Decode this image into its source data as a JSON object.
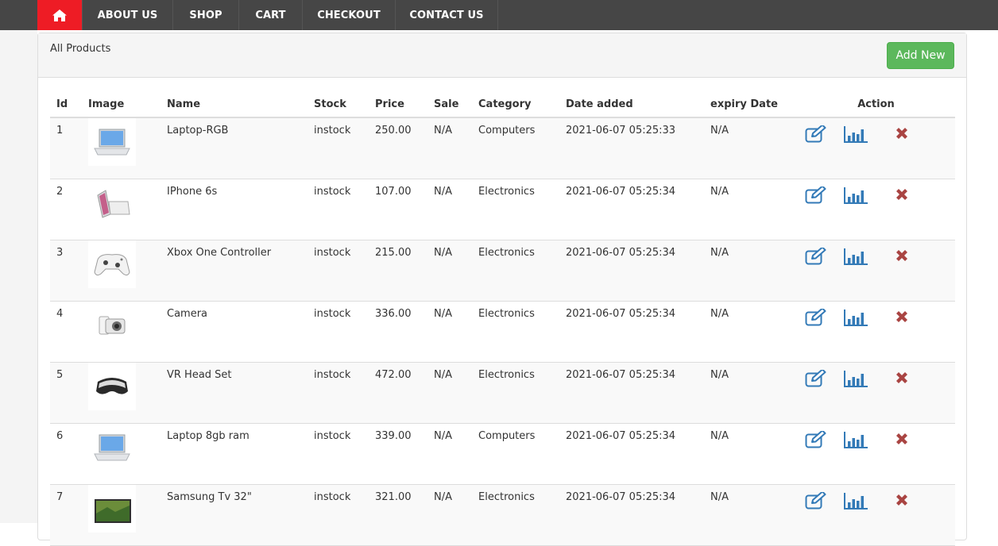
{
  "nav": {
    "home_icon": "home-icon",
    "items": [
      {
        "label": "ABOUT US"
      },
      {
        "label": "SHOP"
      },
      {
        "label": "CART"
      },
      {
        "label": "CHECKOUT"
      },
      {
        "label": "CONTACT US"
      }
    ]
  },
  "panel": {
    "title": "All Products",
    "add_button": "Add New"
  },
  "table": {
    "headers": {
      "id": "Id",
      "image": "Image",
      "name": "Name",
      "stock": "Stock",
      "price": "Price",
      "sale": "Sale",
      "category": "Category",
      "date_added": "Date added",
      "expiry_date": "expiry Date",
      "action": "Action"
    },
    "rows": [
      {
        "id": "1",
        "image": "laptop-image",
        "name": "Laptop-RGB",
        "stock": "instock",
        "price": "250.00",
        "sale": "N/A",
        "category": "Computers",
        "date_added": "2021-06-07 05:25:33",
        "expiry_date": "N/A"
      },
      {
        "id": "2",
        "image": "phone-image",
        "name": "IPhone 6s",
        "stock": "instock",
        "price": "107.00",
        "sale": "N/A",
        "category": "Electronics",
        "date_added": "2021-06-07 05:25:34",
        "expiry_date": "N/A"
      },
      {
        "id": "3",
        "image": "controller-image",
        "name": "Xbox One Controller",
        "stock": "instock",
        "price": "215.00",
        "sale": "N/A",
        "category": "Electronics",
        "date_added": "2021-06-07 05:25:34",
        "expiry_date": "N/A"
      },
      {
        "id": "4",
        "image": "camera-image",
        "name": "Camera",
        "stock": "instock",
        "price": "336.00",
        "sale": "N/A",
        "category": "Electronics",
        "date_added": "2021-06-07 05:25:34",
        "expiry_date": "N/A"
      },
      {
        "id": "5",
        "image": "vr-headset-image",
        "name": "VR Head Set",
        "stock": "instock",
        "price": "472.00",
        "sale": "N/A",
        "category": "Electronics",
        "date_added": "2021-06-07 05:25:34",
        "expiry_date": "N/A"
      },
      {
        "id": "6",
        "image": "laptop-image",
        "name": "Laptop 8gb ram",
        "stock": "instock",
        "price": "339.00",
        "sale": "N/A",
        "category": "Computers",
        "date_added": "2021-06-07 05:25:34",
        "expiry_date": "N/A"
      },
      {
        "id": "7",
        "image": "tv-image",
        "name": "Samsung Tv 32\"",
        "stock": "instock",
        "price": "321.00",
        "sale": "N/A",
        "category": "Electronics",
        "date_added": "2021-06-07 05:25:34",
        "expiry_date": "N/A"
      }
    ],
    "action_icons": [
      "edit-icon",
      "stats-icon",
      "delete-icon"
    ]
  },
  "colors": {
    "nav_bg": "#464646",
    "home_bg": "#ee1c25",
    "add_button_bg": "#5cb85c",
    "action_blue": "#337ab7",
    "delete_red": "#a94442"
  }
}
